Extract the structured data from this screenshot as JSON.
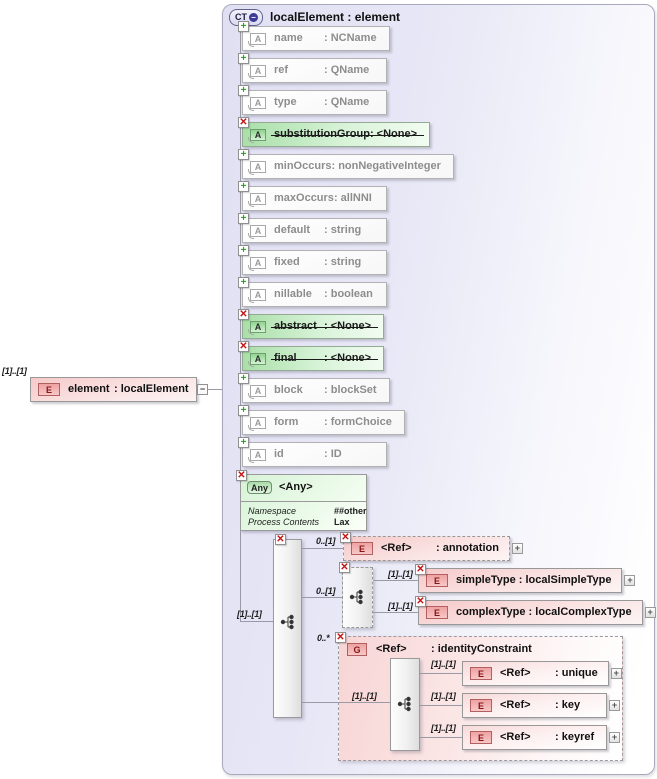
{
  "diagram": {
    "root": {
      "badge": "CT",
      "title": "localElement : element"
    },
    "attribute_badge": "A",
    "element_badge": "E",
    "group_badge": "G",
    "attributes": [
      {
        "name": "name",
        "type": ": NCName",
        "prohibited": false
      },
      {
        "name": "ref",
        "type": ": QName",
        "prohibited": false
      },
      {
        "name": "type",
        "type": ": QName",
        "prohibited": false
      },
      {
        "name": "substitutionGroup",
        "type": ": <None>",
        "prohibited": true
      },
      {
        "name": "minOccurs",
        "type": ": nonNegativeInteger",
        "prohibited": false
      },
      {
        "name": "maxOccurs",
        "type": ": allNNI",
        "prohibited": false
      },
      {
        "name": "default",
        "type": ": string",
        "prohibited": false
      },
      {
        "name": "fixed",
        "type": ": string",
        "prohibited": false
      },
      {
        "name": "nillable",
        "type": ": boolean",
        "prohibited": false
      },
      {
        "name": "abstract",
        "type": ": <None>",
        "prohibited": true
      },
      {
        "name": "final",
        "type": ": <None>",
        "prohibited": true
      },
      {
        "name": "block",
        "type": ": blockSet",
        "prohibited": false
      },
      {
        "name": "form",
        "type": ": formChoice",
        "prohibited": false
      },
      {
        "name": "id",
        "type": ": ID",
        "prohibited": false
      }
    ],
    "any": {
      "badge": "Any",
      "title": "<Any>",
      "rows": [
        {
          "label": "Namespace",
          "value": "##other"
        },
        {
          "label": "Process Contents",
          "value": "Lax"
        }
      ]
    },
    "element": {
      "cardinality": "[1]..[1]",
      "name": "element",
      "type": ": localElement"
    },
    "content": {
      "cardinality": "[1]..[1]",
      "annotation": {
        "cardinality": "0..[1]",
        "name": "<Ref>",
        "type": ": annotation"
      },
      "type_choice": {
        "cardinality": "0..[1]",
        "simpleType": {
          "cardinality": "[1]..[1]",
          "label": "simpleType : localSimpleType"
        },
        "complexType": {
          "cardinality": "[1]..[1]",
          "label": "complexType : localComplexType"
        }
      },
      "identity_constraint": {
        "cardinality": "0..*",
        "name": "<Ref>",
        "type": ": identityConstraint",
        "inner_cardinality": "[1]..[1]",
        "items": [
          {
            "cardinality": "[1]..[1]",
            "name": "<Ref>",
            "type": ": unique"
          },
          {
            "cardinality": "[1]..[1]",
            "name": "<Ref>",
            "type": ": key"
          },
          {
            "cardinality": "[1]..[1]",
            "name": "<Ref>",
            "type": ": keyref"
          }
        ]
      }
    },
    "icons": {
      "add": "+",
      "remove": "✕",
      "expand": "+",
      "collapse": "−"
    },
    "colors": {
      "container_lavender": "#e0e0f3",
      "element_pink": "#f6c9c9",
      "prohibited_green": "#a9dfa9",
      "any_green": "#d7f3d7",
      "remove_red": "#c41414",
      "add_green": "#2ea02e"
    }
  }
}
